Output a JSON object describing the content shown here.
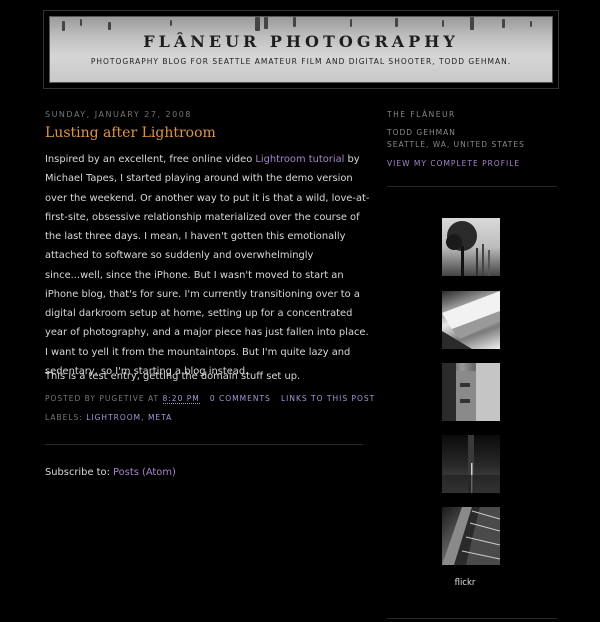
{
  "header": {
    "title": "FLÂNEUR PHOTOGRAPHY",
    "description": "PHOTOGRAPHY BLOG FOR SEATTLE AMATEUR FILM AND DIGITAL SHOOTER, TODD GEHMAN."
  },
  "post": {
    "date": "SUNDAY, JANUARY 27, 2008",
    "title": "Lusting after Lightroom",
    "body_before_link": "Inspired by an excellent, free online video ",
    "link_text": "Lightroom tutorial",
    "body_after_link": " by Michael Tapes, I started playing around with the demo version over the weekend. Or another way to put it is that a wild, love-at-first-site, obsessive relationship materialized over the course of the last three days. I mean, I haven't gotten this emotionally attached to software so suddenly and overwhelmingly since...well, since the iPhone. But I wasn't moved to start an iPhone blog, that's for sure. I'm currently transitioning over to a digital darkroom setup at home, setting up for a concentrated year of photography, and a major piece has just fallen into place. I want to yell it from the mountaintops. But I'm quite lazy and sedentary, so I'm starting a blog instead.",
    "second_paragraph": "This is a test entry, getting the domain stuff set up.",
    "posted_by_label": "POSTED BY PUGETIVE AT",
    "time": "8:20 PM",
    "comments": "0 COMMENTS",
    "permalink": "LINKS TO THIS POST",
    "labels_prefix": "LABELS:",
    "labels": [
      "LIGHTROOM",
      "META"
    ]
  },
  "subscribe": {
    "label": "Subscribe to: ",
    "link": "Posts (Atom)"
  },
  "sidebar": {
    "heading": "THE FLÂNEUR",
    "name": "TODD GEHMAN",
    "location": "SEATTLE, WA, UNITED STATES",
    "profile_link": "VIEW MY COMPLETE PROFILE",
    "flickr_label": "flickr",
    "thumbnails": [
      "tree-photo",
      "architecture-photo",
      "concrete-photo",
      "dark-corridor-photo",
      "escalator-photo"
    ]
  },
  "colors": {
    "background": "#000000",
    "post_title": "#e0944a",
    "link": "#a585c9",
    "footer_link": "#9f9ad6"
  }
}
